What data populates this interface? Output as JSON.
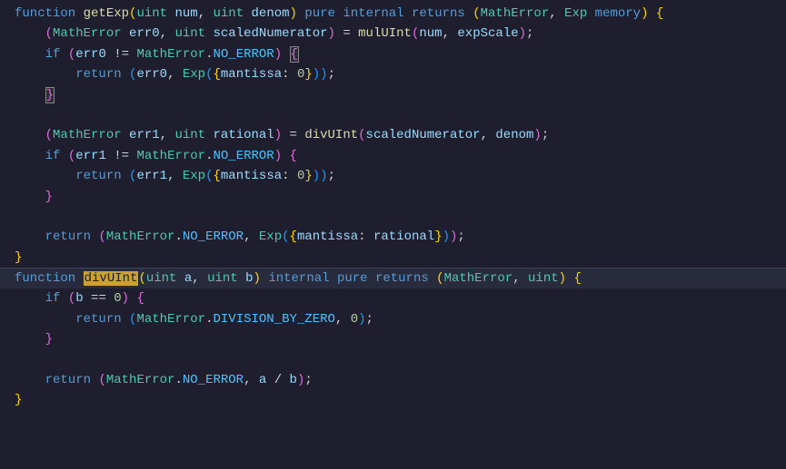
{
  "code": {
    "l1": {
      "kw_function": "function",
      "fn": "getExp",
      "p1_type": "uint",
      "p1_name": "num",
      "p2_type": "uint",
      "p2_name": "denom",
      "mod_pure": "pure",
      "mod_internal": "internal",
      "kw_returns": "returns",
      "ret1": "MathError",
      "ret2_type": "Exp",
      "ret2_kw": "memory"
    },
    "l2": {
      "type": "MathError",
      "var1": "err0",
      "p_type": "uint",
      "var2": "scaledNumerator",
      "fn": "mulUInt",
      "arg1": "num",
      "arg2": "expScale"
    },
    "l3": {
      "kw_if": "if",
      "var": "err0",
      "op": "!=",
      "type": "MathError",
      "member": "NO_ERROR"
    },
    "l4": {
      "kw_return": "return",
      "var": "err0",
      "type": "Exp",
      "prop": "mantissa",
      "val": "0"
    },
    "l7": {
      "type": "MathError",
      "var1": "err1",
      "p_type": "uint",
      "var2": "rational",
      "fn": "divUInt",
      "arg1": "scaledNumerator",
      "arg2": "denom"
    },
    "l8": {
      "kw_if": "if",
      "var": "err1",
      "op": "!=",
      "type": "MathError",
      "member": "NO_ERROR"
    },
    "l9": {
      "kw_return": "return",
      "var": "err1",
      "type": "Exp",
      "prop": "mantissa",
      "val": "0"
    },
    "l12": {
      "kw_return": "return",
      "type": "MathError",
      "member": "NO_ERROR",
      "exp_type": "Exp",
      "prop": "mantissa",
      "val": "rational"
    },
    "l14": {
      "kw_function": "function",
      "fn": "divUInt",
      "p1_type": "uint",
      "p1_name": "a",
      "p2_type": "uint",
      "p2_name": "b",
      "mod_internal": "internal",
      "mod_pure": "pure",
      "kw_returns": "returns",
      "ret1": "MathError",
      "ret2": "uint"
    },
    "l15": {
      "kw_if": "if",
      "var": "b",
      "op": "==",
      "val": "0"
    },
    "l16": {
      "kw_return": "return",
      "type": "MathError",
      "member": "DIVISION_BY_ZERO",
      "val": "0"
    },
    "l19": {
      "kw_return": "return",
      "type": "MathError",
      "member": "NO_ERROR",
      "a": "a",
      "op": "/",
      "b": "b"
    }
  }
}
